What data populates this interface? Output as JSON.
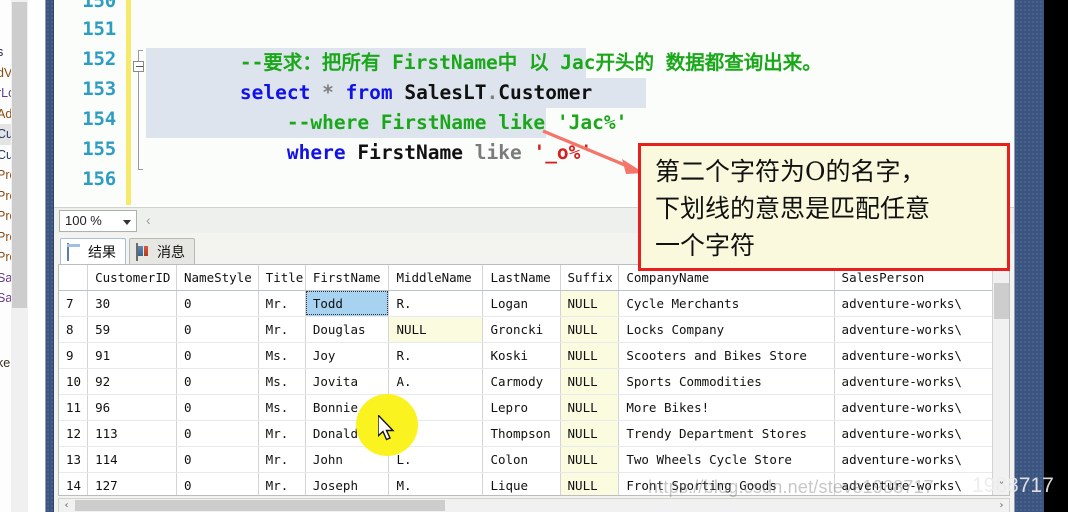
{
  "object_explorer": {
    "items": [
      {
        "label": "s",
        "selected": false
      },
      {
        "label": "dVen",
        "selected": false
      },
      {
        "label": "rLog",
        "selected": false
      },
      {
        "label": "Addr",
        "selected": false
      },
      {
        "label": "Custo",
        "selected": true
      },
      {
        "label": "Custo",
        "selected": false
      },
      {
        "label": "Prod",
        "selected": false
      },
      {
        "label": "Prod",
        "selected": false
      },
      {
        "label": "Prod",
        "selected": false
      },
      {
        "label": "Prod",
        "selected": false
      },
      {
        "label": "Prod",
        "selected": false
      },
      {
        "label": "Sales",
        "selected": false
      },
      {
        "label": "Sales",
        "selected": false
      }
    ],
    "tail_item": "ker"
  },
  "editor": {
    "line_numbers": [
      "150",
      "151",
      "152",
      "153",
      "154",
      "155",
      "156"
    ],
    "lines": [
      {
        "number": "151",
        "tokens": [
          {
            "text": "--要求：把所有 FirstName中 以 Jac开头的 数据都查询出来。",
            "cls": "cmt"
          }
        ]
      },
      {
        "number": "152",
        "tokens": [
          {
            "text": "select",
            "cls": "kw"
          },
          {
            "text": " ",
            "cls": "plain"
          },
          {
            "text": "*",
            "cls": "op"
          },
          {
            "text": " ",
            "cls": "plain"
          },
          {
            "text": "from",
            "cls": "kw"
          },
          {
            "text": " SalesLT",
            "cls": "plain"
          },
          {
            "text": ".",
            "cls": "op"
          },
          {
            "text": "Customer",
            "cls": "plain"
          }
        ]
      },
      {
        "number": "153",
        "tokens": [
          {
            "text": "    --where FirstName like 'Jac%'",
            "cls": "cmt"
          }
        ]
      },
      {
        "number": "154",
        "tokens": [
          {
            "text": "    ",
            "cls": "plain"
          },
          {
            "text": "where",
            "cls": "kw"
          },
          {
            "text": " FirstName ",
            "cls": "plain"
          },
          {
            "text": "like",
            "cls": "like-gr"
          },
          {
            "text": " ",
            "cls": "plain"
          },
          {
            "text": "'_o%'",
            "cls": "str"
          }
        ]
      }
    ]
  },
  "zoom_bar": {
    "value": "100 %",
    "prev_nav": "‹"
  },
  "results": {
    "tabs": [
      {
        "label": "结果",
        "icon": "grid-icon",
        "active": true
      },
      {
        "label": "消息",
        "icon": "message-icon",
        "active": false
      }
    ],
    "columns": [
      "",
      "CustomerID",
      "NameStyle",
      "Title",
      "FirstName",
      "MiddleName",
      "LastName",
      "Suffix",
      "CompanyName",
      "SalesPerson"
    ],
    "rows": [
      {
        "n": "7",
        "CustomerID": "30",
        "NameStyle": "0",
        "Title": "Mr.",
        "FirstName": "Todd",
        "MiddleName": "R.",
        "LastName": "Logan",
        "Suffix": "NULL",
        "CompanyName": "Cycle Merchants",
        "SalesPerson": "adventure-works\\"
      },
      {
        "n": "8",
        "CustomerID": "59",
        "NameStyle": "0",
        "Title": "Mr.",
        "FirstName": "Douglas",
        "MiddleName": "NULL",
        "LastName": "Groncki",
        "Suffix": "NULL",
        "CompanyName": "Locks Company",
        "SalesPerson": "adventure-works\\"
      },
      {
        "n": "9",
        "CustomerID": "91",
        "NameStyle": "0",
        "Title": "Ms.",
        "FirstName": "Joy",
        "MiddleName": "R.",
        "LastName": "Koski",
        "Suffix": "NULL",
        "CompanyName": "Scooters and Bikes Store",
        "SalesPerson": "adventure-works\\"
      },
      {
        "n": "10",
        "CustomerID": "92",
        "NameStyle": "0",
        "Title": "Ms.",
        "FirstName": "Jovita",
        "MiddleName": "A.",
        "LastName": "Carmody",
        "Suffix": "NULL",
        "CompanyName": "Sports Commodities",
        "SalesPerson": "adventure-works\\"
      },
      {
        "n": "11",
        "CustomerID": "96",
        "NameStyle": "0",
        "Title": "Ms.",
        "FirstName": "Bonnie",
        "MiddleName": "B.",
        "LastName": "Lepro",
        "Suffix": "NULL",
        "CompanyName": "More Bikes!",
        "SalesPerson": "adventure-works\\"
      },
      {
        "n": "12",
        "CustomerID": "113",
        "NameStyle": "0",
        "Title": "Mr.",
        "FirstName": "Donald",
        "MiddleName": "M.",
        "LastName": "Thompson",
        "Suffix": "NULL",
        "CompanyName": "Trendy Department Stores",
        "SalesPerson": "adventure-works\\"
      },
      {
        "n": "13",
        "CustomerID": "114",
        "NameStyle": "0",
        "Title": "Mr.",
        "FirstName": "John",
        "MiddleName": "L.",
        "LastName": "Colon",
        "Suffix": "NULL",
        "CompanyName": "Two Wheels Cycle Store",
        "SalesPerson": "adventure-works\\"
      },
      {
        "n": "14",
        "CustomerID": "127",
        "NameStyle": "0",
        "Title": "Mr.",
        "FirstName": "Joseph",
        "MiddleName": "M.",
        "LastName": "Lique",
        "Suffix": "NULL",
        "CompanyName": "Front Sporting Goods",
        "SalesPerson": "adventure-works\\"
      }
    ],
    "selected_cell": {
      "row": 0,
      "column": "FirstName",
      "value": "Todd"
    },
    "scroll_up_glyph": "˄",
    "scroll_down_glyph": "˅",
    "hscroll_left_glyph": "‹",
    "hscroll_right_glyph": "›"
  },
  "annotation": {
    "lines": [
      "第二个字符为O的名字，",
      "下划线的意思是匹配任意",
      "一个字符"
    ],
    "border_color": "#e81f1f",
    "background_color": "#fbf9dd"
  },
  "watermark": {
    "url_text": "https://blog.csdn.net/steve1988717",
    "tail_text": "1988717"
  },
  "colors": {
    "keyword": "#1212e8",
    "comment": "#1aa81a",
    "string": "#d42020",
    "line_number": "#2e9dc4",
    "change_bar": "#f7e96a",
    "selection": "#dde4ee",
    "null_cell": "#fbfbe0",
    "selected_cell": "#a8d3f0",
    "spotlight": "#fbf320",
    "splitter": "#3b5480"
  }
}
